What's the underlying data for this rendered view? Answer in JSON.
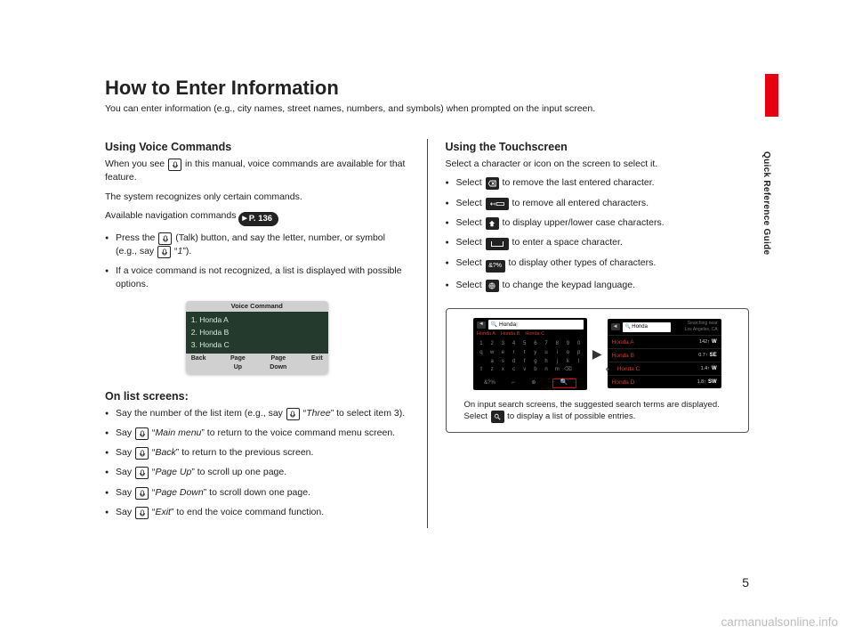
{
  "side_label": "Quick Reference Guide",
  "title": "How to Enter Information",
  "subtitle": "You can enter information (e.g., city names, street names, numbers, and symbols) when prompted on the input screen.",
  "page_num": "5",
  "watermark": "carmanualsonline.info",
  "voice": {
    "heading": "Using Voice Commands",
    "intro_a": "When you see ",
    "intro_b": " in this manual, voice commands are available for that feature.",
    "recognize": "The system recognizes only certain commands.",
    "avail_nav": "Available navigation commands ",
    "page_ref": "P. 136",
    "bullets": [
      {
        "a": "Press the ",
        "b": " (Talk) button, and say the letter, number, or symbol (e.g., say ",
        "c": " “",
        "d": "1",
        "e": "”)."
      },
      {
        "full": "If a voice command is not recognized, a list is displayed with possible options."
      }
    ],
    "img_title": "Voice Command",
    "img_items": [
      "1. Honda A",
      "2. Honda B",
      "3. Honda C"
    ],
    "img_bottom": [
      "Back",
      "Page\nUp",
      "Page\nDown",
      "Exit"
    ]
  },
  "list": {
    "heading": "On list screens:",
    "items": [
      {
        "a": "Say the number of the list item (e.g., say ",
        "b": " “",
        "c": "Three",
        "d": "” to select item 3)."
      },
      {
        "a": "Say ",
        "b": " “",
        "c": "Main menu",
        "d": "” to return to the voice command menu screen."
      },
      {
        "a": "Say ",
        "b": " “",
        "c": "Back",
        "d": "” to return to the previous screen."
      },
      {
        "a": "Say ",
        "b": " “",
        "c": "Page Up",
        "d": "” to scroll up one page."
      },
      {
        "a": "Say ",
        "b": " “",
        "c": "Page Down",
        "d": "” to scroll down one page."
      },
      {
        "a": "Say ",
        "b": " “",
        "c": "Exit",
        "d": "” to end the voice command function."
      }
    ]
  },
  "touch": {
    "heading": "Using the Touchscreen",
    "intro": "Select a character or icon on the screen to select it.",
    "bullets": [
      {
        "a": "Select ",
        "icon": "del-x",
        "b": " to remove the last entered character."
      },
      {
        "a": "Select ",
        "icon": "del-left",
        "b": " to remove all entered characters."
      },
      {
        "a": "Select ",
        "icon": "shift",
        "b": " to display upper/lower case characters."
      },
      {
        "a": "Select ",
        "icon": "space",
        "b": " to enter a space character."
      },
      {
        "a": "Select ",
        "icon": "amp-q",
        "b": " to display other types of characters."
      },
      {
        "a": "Select ",
        "icon": "globe",
        "b": " to change the keypad language."
      }
    ],
    "kb_search": "Honda",
    "kb_sugg": [
      "Honda A",
      "Honda B",
      "Honda C"
    ],
    "list_search": "Honda",
    "list_loc_a": "Searching near",
    "list_loc_b": "Los Angeles, CA",
    "list_rows": [
      {
        "nm": "Honda A",
        "dist": "142↑",
        "dir": "W"
      },
      {
        "nm": "Honda B",
        "dist": "0.7↑",
        "dir": "SE"
      },
      {
        "nm": "Honda C",
        "dist": "1.4↑",
        "dir": "W"
      },
      {
        "nm": "Honda D",
        "dist": "1.8↑",
        "dir": "SW"
      }
    ],
    "caption_a": "On input search screens, the suggested search terms are displayed. Select ",
    "caption_b": " to display a list of possible entries."
  }
}
